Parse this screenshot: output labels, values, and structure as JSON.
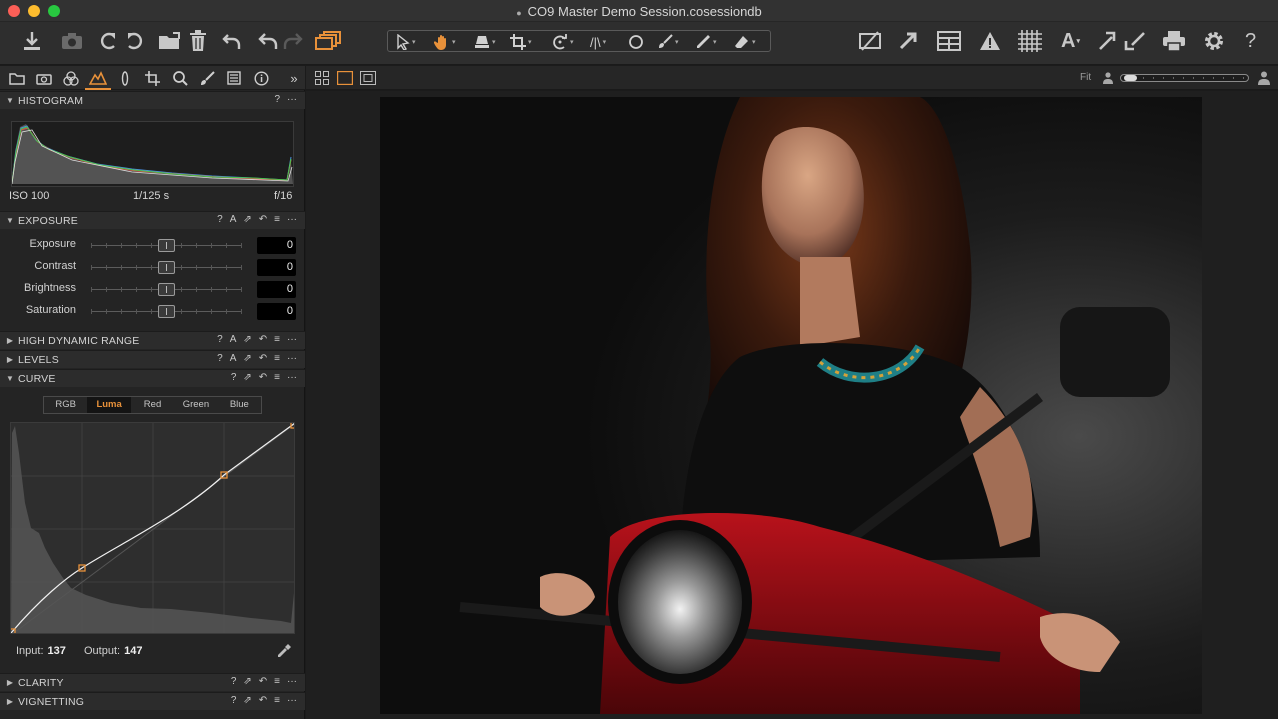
{
  "window": {
    "title": "CO9 Master Demo Session.cosessiondb"
  },
  "toolbar": {
    "left_icons": [
      "import-icon",
      "camera-capture-icon",
      "rotate-left-icon",
      "rotate-right-icon",
      "move-to-folder-icon",
      "trash-icon",
      "undo-icon",
      "undo-step-icon",
      "redo-step-icon",
      "variants-icon"
    ],
    "cursor_tools": [
      "select-cursor-icon",
      "pan-hand-icon",
      "loupe-icon",
      "crop-icon",
      "rotate-tool-icon",
      "keystone-icon",
      "mask-circle-icon",
      "brush-icon",
      "picker-icon",
      "eraser-icon"
    ],
    "right_icons": [
      "proof-toggle-icon",
      "expand-icon",
      "grid-view-icon",
      "exposure-warning-icon",
      "grid-overlay-icon",
      "annotations-icon",
      "copy-adjustments-icon",
      "print-icon",
      "settings-gear-icon",
      "help-icon"
    ],
    "annotation_letter": "A"
  },
  "tool_tabs": [
    "library-icon",
    "capture-icon",
    "color-icon",
    "exposure-icon",
    "lens-icon",
    "crop-icon",
    "details-icon",
    "adjustments-icon",
    "metadata-icon",
    "info-icon",
    "more-icon"
  ],
  "histogram": {
    "title": "HISTOGRAM",
    "iso": "ISO 100",
    "shutter": "1/125 s",
    "aperture": "f/16"
  },
  "exposure": {
    "title": "EXPOSURE",
    "sliders": [
      {
        "label": "Exposure",
        "value": "0"
      },
      {
        "label": "Contrast",
        "value": "0"
      },
      {
        "label": "Brightness",
        "value": "0"
      },
      {
        "label": "Saturation",
        "value": "0"
      }
    ]
  },
  "sections": {
    "hdr": "HIGH DYNAMIC RANGE",
    "levels": "LEVELS",
    "curve": "CURVE",
    "clarity": "CLARITY",
    "vignetting": "VIGNETTING"
  },
  "curve": {
    "tabs": [
      "RGB",
      "Luma",
      "Red",
      "Green",
      "Blue"
    ],
    "active_tab": "Luma",
    "input_label": "Input:",
    "input_value": "137",
    "output_label": "Output:",
    "output_value": "147"
  },
  "section_tool_glyphs": {
    "help": "?",
    "auto": "A",
    "menu": "≡",
    "more": "···"
  },
  "viewer": {
    "zoom_label": "Fit"
  },
  "colors": {
    "accent": "#e8913a",
    "panel": "#242424",
    "toolbar": "#2e2e2e"
  }
}
